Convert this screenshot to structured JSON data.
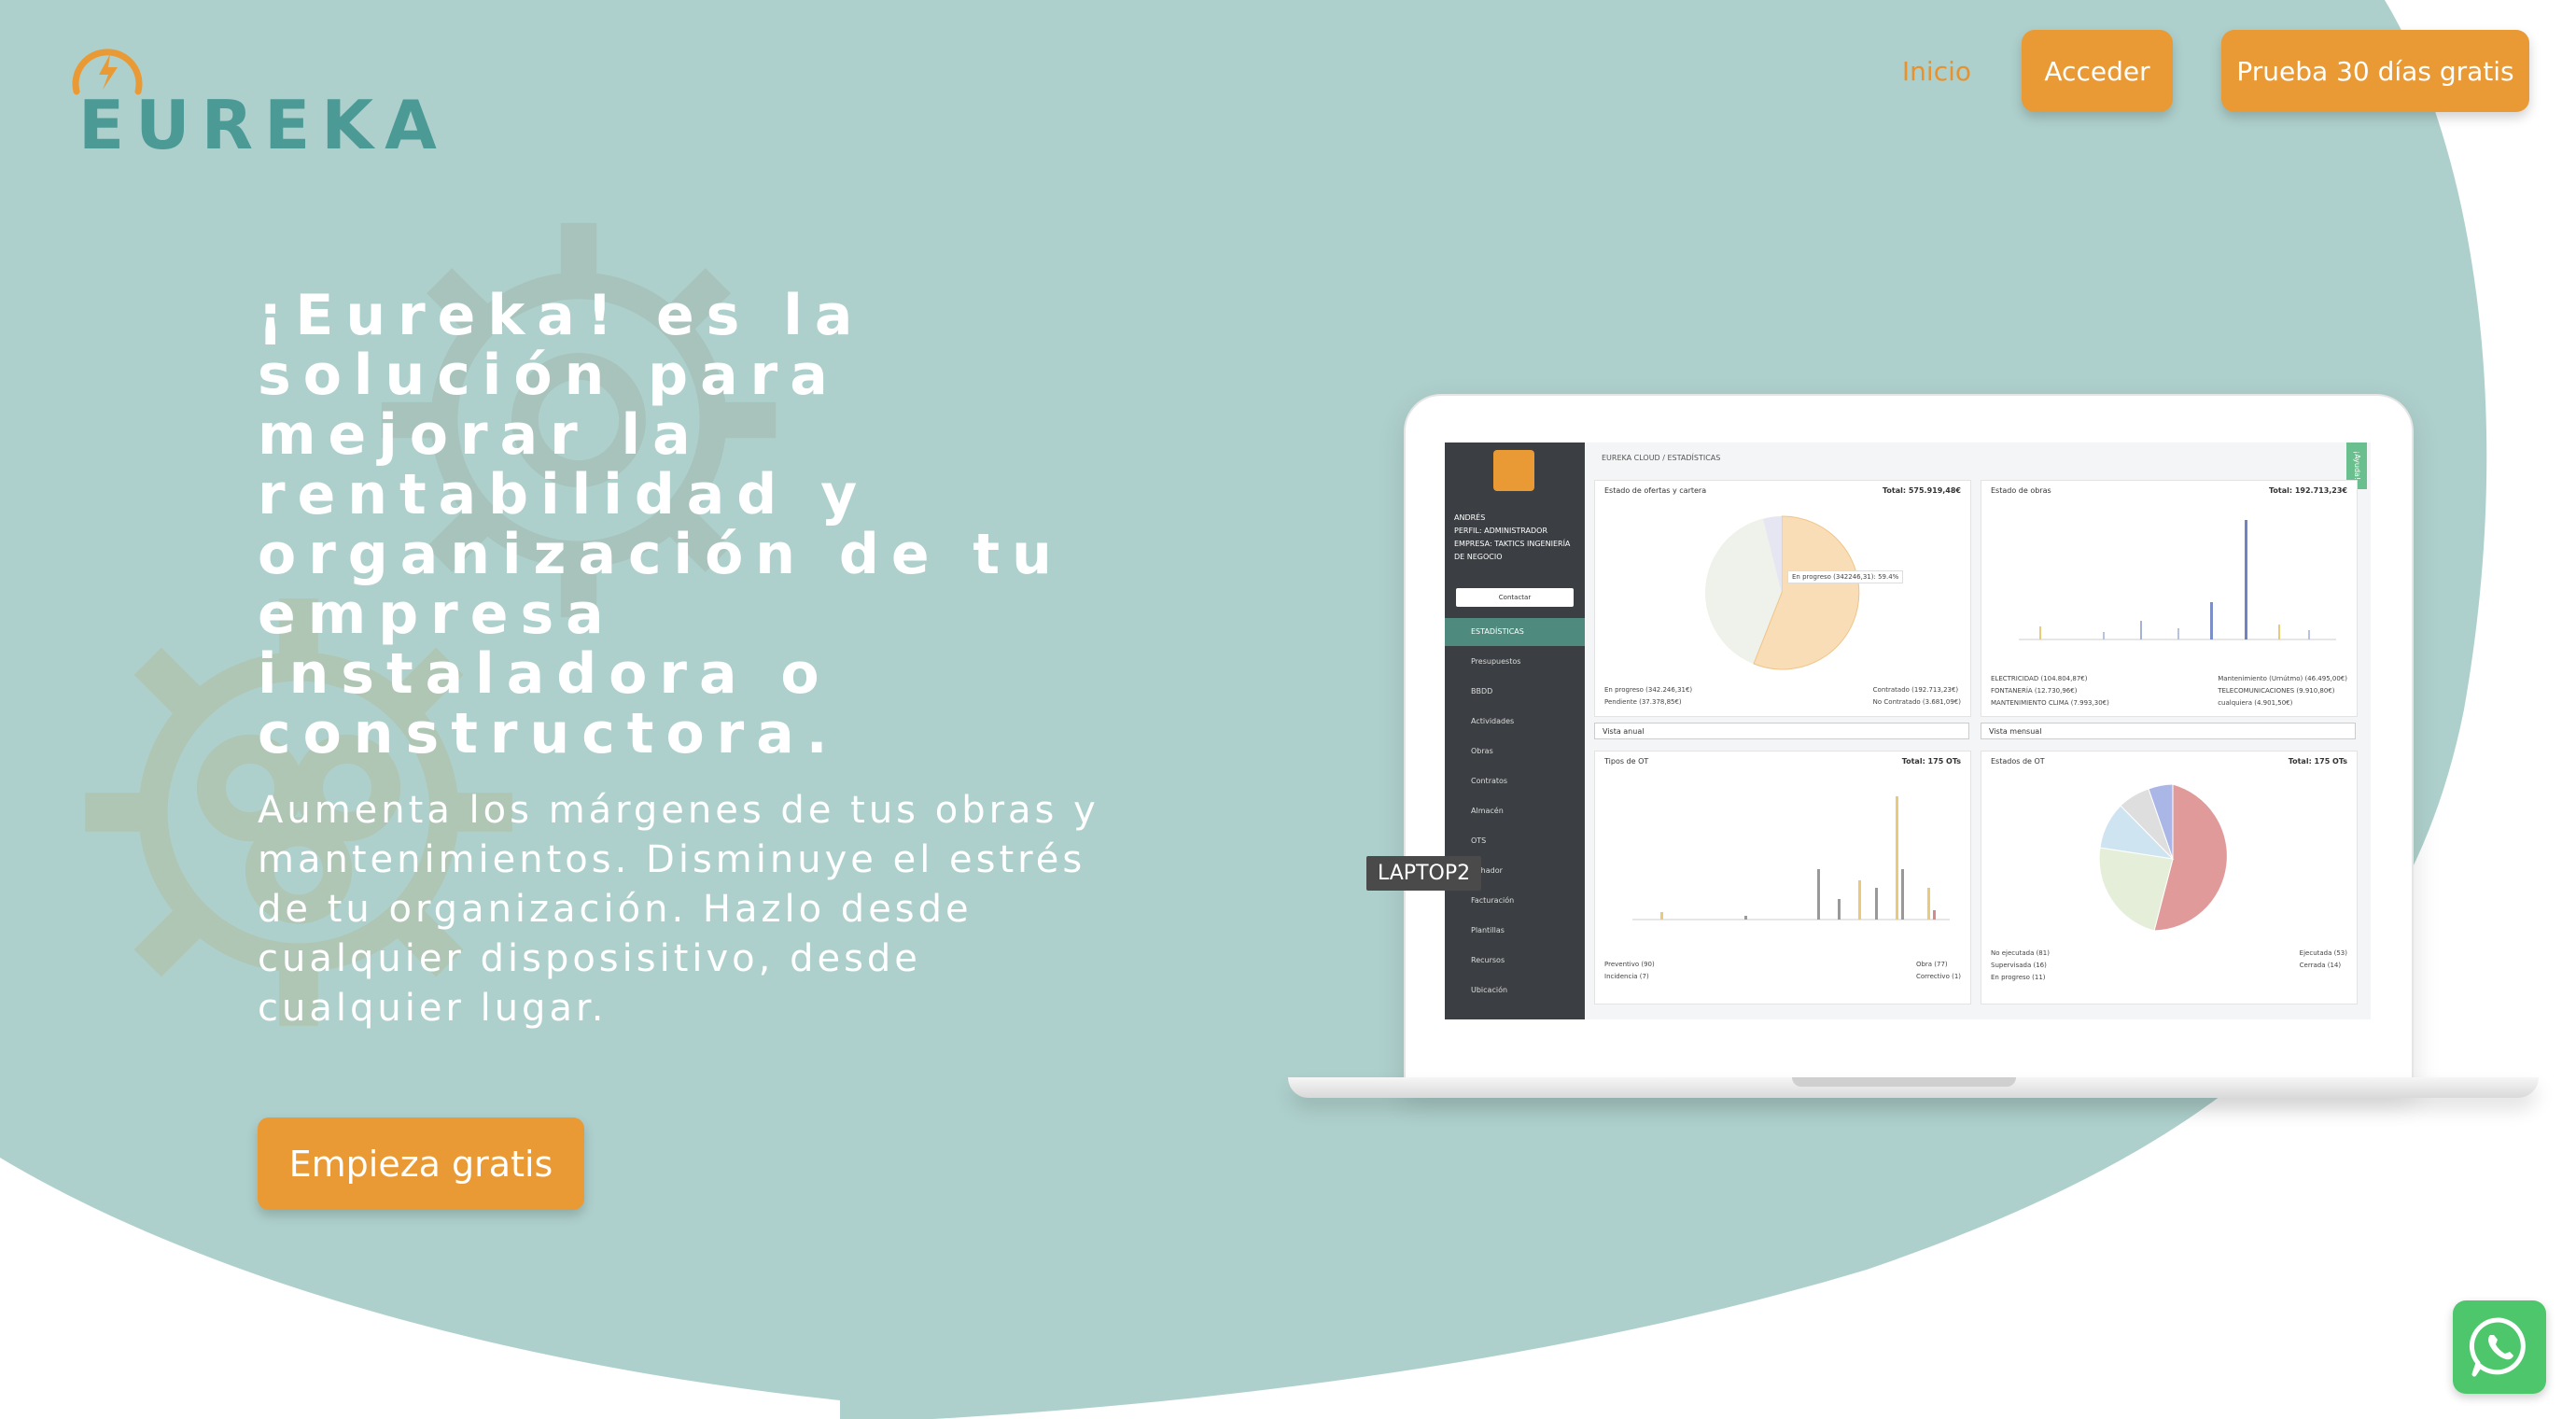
{
  "colors": {
    "background_blob": "#aed0cc",
    "accent_orange": "#e99a35",
    "logo_teal": "#4c9a96",
    "white": "#ffffff",
    "whatsapp_green": "#4ec76c"
  },
  "logo": {
    "wordmark": "EUREKA",
    "icon": "lightbulb-bolt-icon"
  },
  "nav": {
    "home": "Inicio",
    "login": "Acceder",
    "trial": "Prueba 30 días gratis"
  },
  "hero": {
    "headline": "¡Eureka! es la solución para mejorar la rentabilidad y organización de tu empresa instaladora o constructora.",
    "subtext": "Aumenta los márgenes de tus obras y mantenimientos. Disminuye el estrés de tu organización. Hazlo desde cualquier disposisitivo, desde cualquier lugar.",
    "cta": "Empieza gratis"
  },
  "laptop_label": "LAPTOP2",
  "whatsapp": {
    "icon": "whatsapp-icon"
  },
  "dashboard": {
    "breadcrumb": "EUREKA CLOUD  /  ESTADÍSTICAS",
    "help_tab": "¡Ayuda!",
    "sidebar_user": "ANDRÉS",
    "sidebar_profile": "PERFIL: ADMINISTRADOR",
    "sidebar_company": "EMPRESA: TAKTICS INGENIERÍA DE NEGOCIO",
    "sidebar_button": "Contactar",
    "sidebar_items": [
      "ESTADÍSTICAS",
      "Presupuestos",
      "BBDD",
      "Actividades",
      "Obras",
      "Contratos",
      "Almacén",
      "OTS",
      "Fichador",
      "Facturación",
      "Plantillas",
      "Recursos",
      "Ubicación"
    ],
    "panels": {
      "offers": {
        "title": "Estado de ofertas y cartera",
        "total": "Total: 575.919,48€",
        "tooltip": "En progreso (342246,31): 59.4%",
        "legend_left": [
          "En progreso (342.246,31€)",
          "Pendiente (37.378,85€)"
        ],
        "legend_right": [
          "Contratado (192.713,23€)",
          "No Contratado (3.681,09€)"
        ],
        "select": "Vista anual"
      },
      "works": {
        "title": "Estado de obras",
        "total": "Total: 192.713,23€",
        "legend_left": [
          "ELECTRICIDAD (104.804,87€)",
          "FONTANERÍA (12.730,96€)",
          "MANTENIMIENTO CLIMA (7.993,30€)"
        ],
        "legend_right": [
          "Mantenimiento (Urnútmo) (46.495,00€)",
          "TELECOMUNICACIONES (9.910,80€)",
          "cualquiera (4.901,50€)"
        ],
        "select": "Vista mensual"
      },
      "ot_types": {
        "title": "Tipos de OT",
        "total": "Total: 175 OTs",
        "legend_left": [
          "Preventivo (90)",
          "Incidencia (7)"
        ],
        "legend_right": [
          "Obra (77)",
          "Correctivo (1)"
        ]
      },
      "ot_states": {
        "title": "Estados de OT",
        "total": "Total: 175 OTs",
        "legend_left": [
          "No ejecutada (81)",
          "Supervisada (16)",
          "En progreso (11)"
        ],
        "legend_right": [
          "Ejecutada (53)",
          "Cerrada (14)"
        ]
      }
    }
  }
}
